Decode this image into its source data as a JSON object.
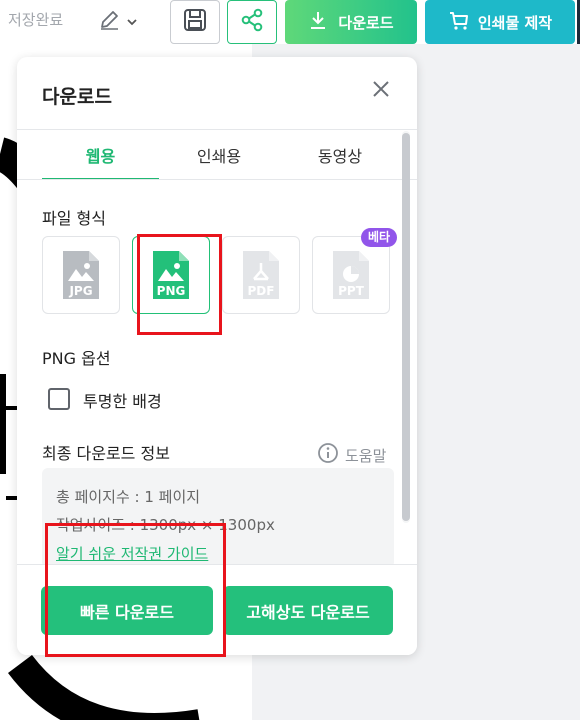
{
  "topbar": {
    "save_status": "저장완료",
    "download_label": "다운로드",
    "print_label": "인쇄물 제작",
    "icons": {
      "edit": "pencil-icon",
      "dropdown": "chevron-down-icon",
      "save": "floppy-disk-icon",
      "share": "share-icon",
      "download": "download-icon",
      "print": "cart-icon"
    }
  },
  "panel": {
    "title": "다운로드",
    "close_icon": "close-icon",
    "tabs": [
      {
        "label": "웹용",
        "active": true
      },
      {
        "label": "인쇄용",
        "active": false
      },
      {
        "label": "동영상",
        "active": false
      }
    ],
    "file_format": {
      "label": "파일 형식",
      "options": [
        {
          "label": "JPG",
          "selected": false
        },
        {
          "label": "PNG",
          "selected": true
        },
        {
          "label": "PDF",
          "selected": false
        },
        {
          "label": "PPT",
          "selected": false
        }
      ],
      "beta_badge": "베타"
    },
    "png_options": {
      "label": "PNG 옵션",
      "transparent_label": "투명한 배경",
      "transparent_checked": false
    },
    "final_info": {
      "label": "최종 다운로드 정보",
      "help_label": "도움말",
      "pages": "총 페이지수 : 1 페이지",
      "size": "작업사이즈 : 1300px × 1300px",
      "copyright_link": "알기 쉬운 저작권 가이드"
    },
    "buttons": {
      "fast": "빠른 다운로드",
      "hq": "고해상도 다운로드"
    }
  },
  "colors": {
    "accent_green": "#22c077",
    "print_teal": "#1eb9c9",
    "beta_purple": "#9155ea",
    "annotation_red": "#e8141c"
  }
}
